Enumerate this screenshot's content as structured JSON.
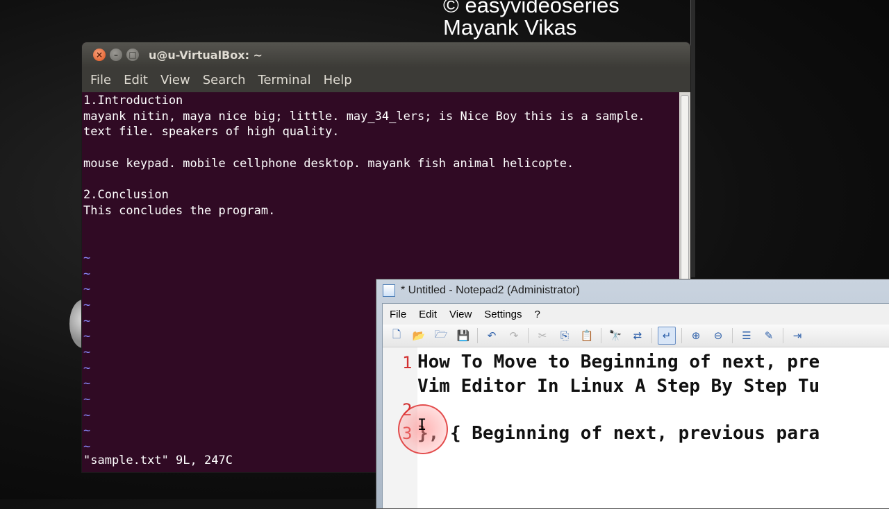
{
  "watermark": {
    "line1": "© easyvideoseries",
    "line2": "Mayank Vikas"
  },
  "terminal": {
    "title": "u@u-VirtualBox: ~",
    "menu": [
      "File",
      "Edit",
      "View",
      "Search",
      "Terminal",
      "Help"
    ],
    "lines": [
      "1.Introduction",
      "mayank nitin, maya nice big; little. may_34_lers; is Nice Boy this is a sample.",
      "text file. speakers of high quality.",
      "",
      "mouse keypad. mobile cellphone desktop. mayank fish animal helicopte.",
      "",
      "2.Conclusion",
      "This concludes the program.",
      "",
      ""
    ],
    "tilde": "~",
    "status": "\"sample.txt\" 9L, 247C"
  },
  "notepad": {
    "title": "* Untitled - Notepad2 (Administrator)",
    "menu": [
      "File",
      "Edit",
      "View",
      "Settings",
      "?"
    ],
    "line_numbers": [
      "1",
      "2",
      "3"
    ],
    "lines": [
      "How To Move to Beginning of next, pre",
      "Vim Editor In Linux A Step By Step Tu",
      "}, { Beginning of next, previous para"
    ]
  },
  "colors": {
    "terminal_bg": "#300a24",
    "line_number": "#d23030"
  }
}
